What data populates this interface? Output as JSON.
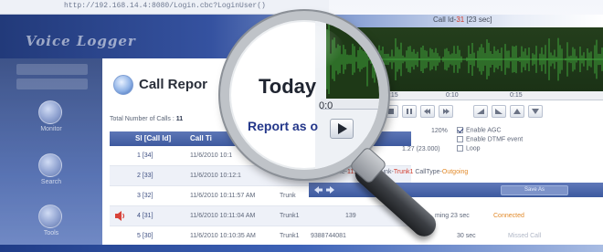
{
  "browser": {
    "address": "http://192.168.14.4:8080/Login.cbc?LoginUser()"
  },
  "app": {
    "title": "Voice Logger"
  },
  "sidebar": {
    "items": [
      {
        "label": "Monitor",
        "icon": "monitor-icon"
      },
      {
        "label": "Search",
        "icon": "search-icon"
      },
      {
        "label": "Tools",
        "icon": "tools-icon"
      }
    ]
  },
  "report": {
    "title": "Call Repor",
    "total_label": "Total Number of Calls :",
    "total_value": "11"
  },
  "table": {
    "headers": [
      "Sl [Call Id]",
      "Call Ti"
    ],
    "rows": [
      {
        "id": "1 [34]",
        "time": "11/6/2010 10:1",
        "trunk": "",
        "number": "",
        "duration": "",
        "type": ""
      },
      {
        "id": "2 [33]",
        "time": "11/6/2010 10:12:1",
        "trunk": "",
        "number": "",
        "duration": "",
        "type": ""
      },
      {
        "id": "3 [32]",
        "time": "11/6/2010 10:11:57 AM",
        "trunk": "Trunk",
        "number": "",
        "duration": "",
        "type": ""
      },
      {
        "id": "4 [31]",
        "time": "11/6/2010 10:11:04 AM",
        "trunk": "Trunk1",
        "number": "139",
        "duration": "ming 23 sec",
        "type": "Connected"
      },
      {
        "id": "5 [30]",
        "time": "11/6/2010 10:10:35 AM",
        "trunk": "Trunk1",
        "number": "9388744081",
        "duration": "30 sec",
        "type": "Missed Call"
      }
    ]
  },
  "player": {
    "call_id_label": "Call Id-",
    "call_id_value": "31",
    "call_duration": "[23 sec]",
    "ruler": [
      "0:15",
      "0:10",
      "0:15"
    ],
    "zoom": "120%",
    "options": [
      {
        "label": "Enable AGC",
        "checked": true
      },
      {
        "label": "Enable DTMF event",
        "checked": false
      },
      {
        "label": "Loop",
        "checked": false
      }
    ],
    "time_display": "1.27 (23.000)",
    "info_prefix": "rTime-",
    "info_time": "11:04 AM",
    "info_trunk_label": "Trunk-",
    "info_trunk": "Trunk1",
    "info_type_label": "CallType-",
    "info_type": "Outgoing",
    "save_label": "Save As"
  },
  "magnifier": {
    "today": "Today",
    "report_as": "Report as o",
    "time": "0:0"
  },
  "colors": {
    "accent": "#3d5a9f",
    "waveform": "#3fa33a",
    "alert": "#d23a2a"
  }
}
